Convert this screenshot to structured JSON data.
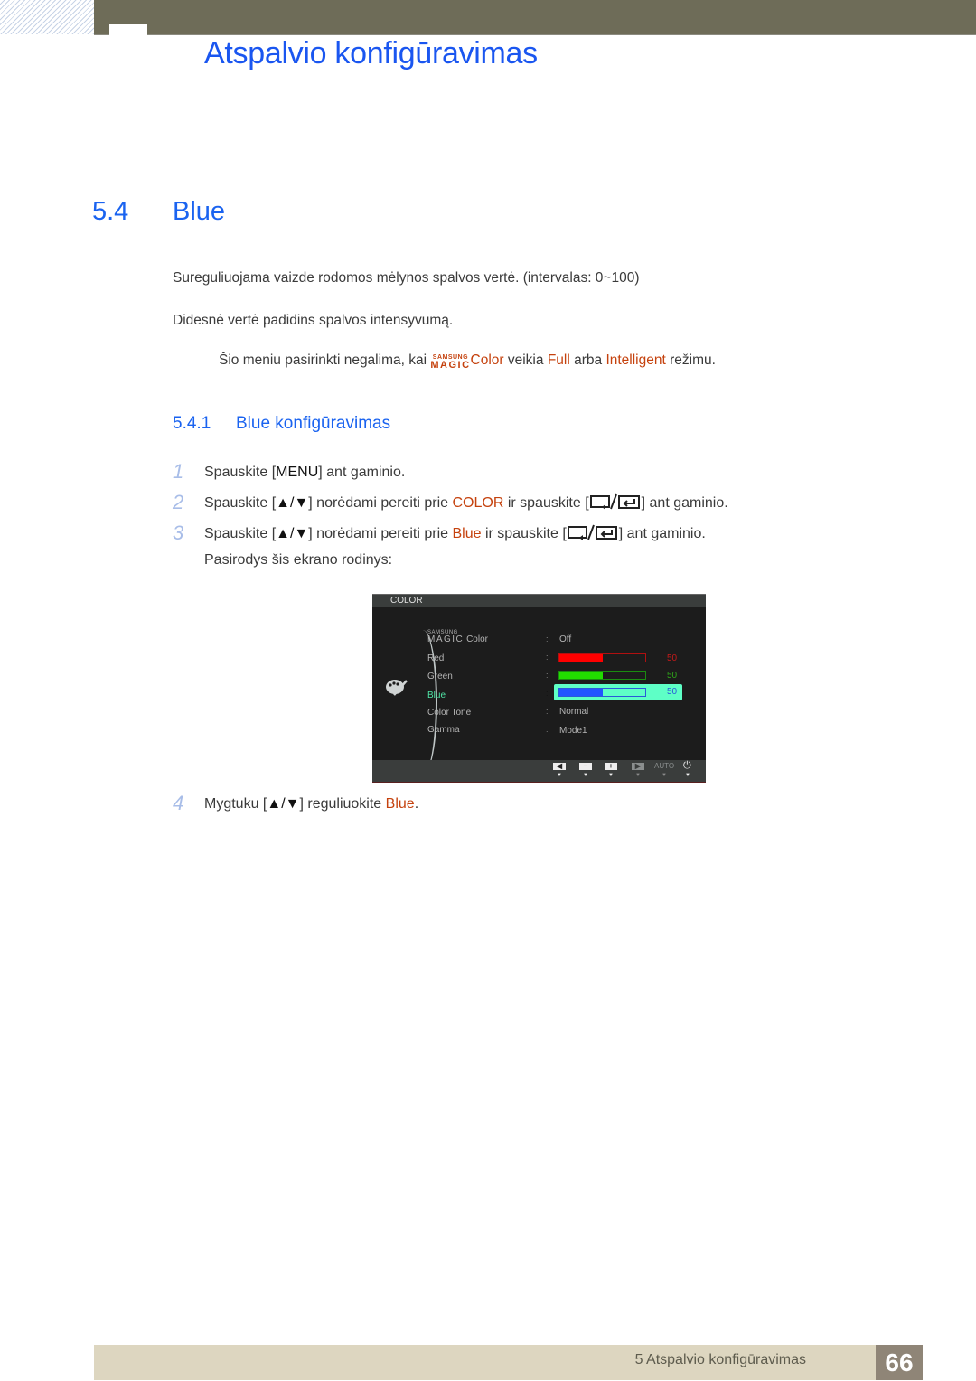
{
  "header": {
    "chapter_title": "Atspalvio konfigūravimas"
  },
  "section": {
    "number": "5.4",
    "title": "Blue",
    "paragraphs": [
      "Sureguliuojama vaizde rodomos mėlynos spalvos vertė. (intervalas: 0~100)",
      "Didesnė vertė padidins spalvos intensyvumą."
    ],
    "note": {
      "prefix": "Šio meniu pasirinkti negalima, kai ",
      "magic_top": "SAMSUNG",
      "magic_bottom": "MAGIC",
      "color_word": "Color",
      "mid1": " veikia ",
      "full": "Full",
      "mid2": " arba ",
      "intelligent": "Intelligent",
      "suffix": " režimu."
    }
  },
  "subsection": {
    "number": "5.4.1",
    "title": "Blue konfigūravimas",
    "steps": [
      {
        "n": "1",
        "a": "Spauskite [",
        "key": "MENU",
        "b": "] ant gaminio."
      },
      {
        "n": "2",
        "a": "Spauskite [",
        "key": "▲/▼",
        "b": "] norėdami pereiti prie ",
        "hl": "COLOR",
        "c": " ir spauskite [",
        "d": "] ant gaminio."
      },
      {
        "n": "3",
        "a": "Spauskite [",
        "key": "▲/▼",
        "b": "] norėdami pereiti prie ",
        "hl": "Blue",
        "c": " ir spauskite [",
        "d": "] ant gaminio."
      },
      {
        "n": "",
        "a": "Pasirodys šis ekrano rodinys:"
      },
      {
        "n": "4",
        "a": "Mygtuku [",
        "key": "▲/▼",
        "b": "] reguliuokite ",
        "hl": "Blue",
        "c": "."
      }
    ]
  },
  "osd": {
    "title": "COLOR",
    "menu_icon": "palette-icon",
    "items": [
      {
        "label_top": "SAMSUNG",
        "label_main": "MAGIC",
        "label_suffix": "Color",
        "value": "Off"
      },
      {
        "label": "Red",
        "value": 50,
        "bar_color": "#ff0000",
        "num_color": "#c41a1a"
      },
      {
        "label": "Green",
        "value": 50,
        "bar_color": "#22dd00",
        "num_color": "#2fa61a"
      },
      {
        "label": "Blue",
        "value": 50,
        "bar_color": "#2255ff",
        "num_color": "#2a5ad8",
        "active": true
      },
      {
        "label": "Color Tone",
        "value": "Normal"
      },
      {
        "label": "Gamma",
        "value": "Mode1"
      }
    ],
    "footer_buttons": [
      "left-icon",
      "minus-icon",
      "plus-icon",
      "enter-icon",
      "AUTO",
      "power-icon"
    ],
    "highlight_color": "#5effc6"
  },
  "footer": {
    "text": "5 Atspalvio konfigūravimas",
    "page": "66"
  }
}
